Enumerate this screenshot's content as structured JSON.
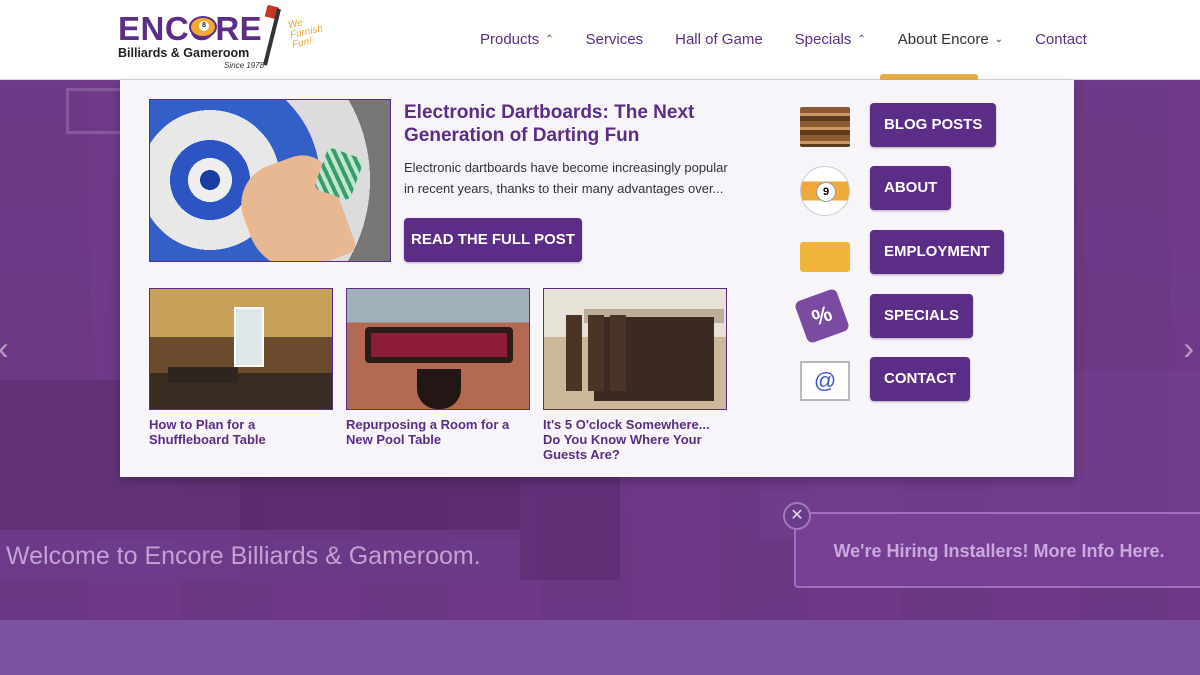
{
  "header": {
    "logo_word": "ENCORE",
    "logo_sub": "Billiards & Gameroom",
    "logo_since": "Since 1978",
    "logo_tagline": "We Furnish Fun!"
  },
  "nav": {
    "items": [
      {
        "label": "Products",
        "chevron": "⌃"
      },
      {
        "label": "Services",
        "chevron": ""
      },
      {
        "label": "Hall of Game",
        "chevron": ""
      },
      {
        "label": "Specials",
        "chevron": "⌃"
      },
      {
        "label": "About Encore",
        "chevron": "⌄"
      },
      {
        "label": "Contact",
        "chevron": ""
      }
    ]
  },
  "mega": {
    "featured": {
      "title": "Electronic Dartboards: The Next Generation of Darting Fun",
      "excerpt": "Electronic dartboards have become increasingly popular in recent years, thanks to their many advantages over...",
      "button": "READ THE FULL POST"
    },
    "posts": [
      {
        "caption": "How to Plan for a Shuffleboard Table"
      },
      {
        "caption": "Repurposing a Room for a New Pool Table"
      },
      {
        "caption": "It's 5 O'clock Somewhere... Do You Know Where Your Guests Are?"
      }
    ],
    "side_links": [
      {
        "label": "BLOG POSTS",
        "icon": "books-icon"
      },
      {
        "label": "ABOUT",
        "icon": "billiard-ball-icon",
        "ball_number": "9"
      },
      {
        "label": "EMPLOYMENT",
        "icon": "toolbox-icon"
      },
      {
        "label": "SPECIALS",
        "icon": "price-tag-icon",
        "glyph": "%"
      },
      {
        "label": "CONTACT",
        "icon": "mail-phone-icon",
        "glyph": "@"
      }
    ]
  },
  "hero": {
    "welcome": "Welcome to Encore Billiards & Gameroom.",
    "hiring": "We're Hiring Installers! More Info Here.",
    "close_glyph": "✕",
    "prev_glyph": "‹",
    "next_glyph": "›"
  },
  "colors": {
    "brand_purple": "#5b2d86",
    "accent_orange": "#e8b04a"
  }
}
